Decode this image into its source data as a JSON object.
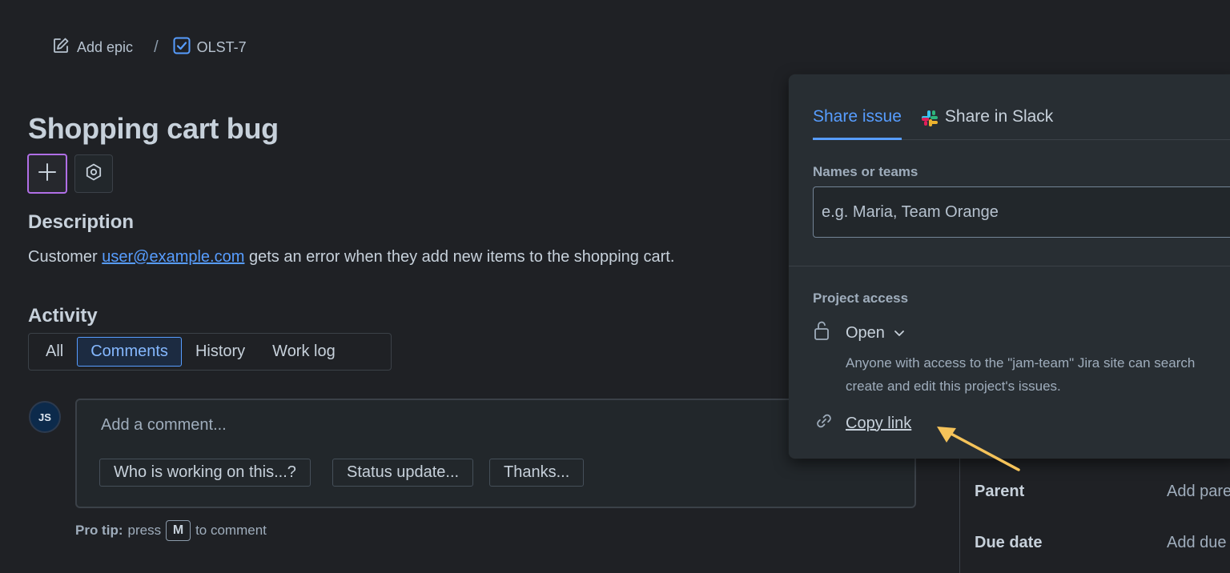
{
  "breadcrumb": {
    "epic_label": "Add epic",
    "separator": "/",
    "issue_key": "OLST-7"
  },
  "issue": {
    "title": "Shopping cart bug"
  },
  "description": {
    "heading": "Description",
    "text_before": "Customer ",
    "email": "user@example.com",
    "text_after": " gets an error when they add new items to the shopping cart."
  },
  "activity": {
    "heading": "Activity",
    "tabs": [
      {
        "label": "All",
        "active": false
      },
      {
        "label": "Comments",
        "active": true
      },
      {
        "label": "History",
        "active": false
      },
      {
        "label": "Work log",
        "active": false
      }
    ]
  },
  "comment": {
    "avatar_initials": "JS",
    "placeholder": "Add a comment...",
    "quick_replies": [
      "Who is working on this...?",
      "Status update...",
      "Thanks..."
    ],
    "protip_bold": "Pro tip:",
    "protip_press": "press",
    "protip_key": "M",
    "protip_suffix": "to comment"
  },
  "details": {
    "rows": [
      {
        "label": "Parent",
        "value": "Add parent"
      },
      {
        "label": "Due date",
        "value": "Add due date"
      }
    ]
  },
  "share": {
    "tabs": [
      {
        "label": "Share issue",
        "active": true
      },
      {
        "label": "Share in Slack",
        "active": false
      }
    ],
    "names_label": "Names or teams",
    "names_placeholder": "e.g. Maria, Team Orange",
    "access_label": "Project access",
    "access_value": "Open",
    "access_description_line1": "Anyone with access to the \"jam-team\" Jira site can search",
    "access_description_line2": "create and edit this project's issues.",
    "copy_link_label": "Copy link"
  },
  "colors": {
    "background": "#1f2125",
    "accent": "#579dff",
    "focus_ring": "#b06fe6",
    "annotation_arrow": "#f5c35a"
  },
  "icons": {
    "epic": "edit-icon",
    "issue_type": "checkbox-icon",
    "add": "plus-icon",
    "settings": "hexagon-settings-icon",
    "slack": "slack-icon",
    "lock": "unlock-icon",
    "chevron": "chevron-down-icon",
    "link": "link-icon"
  }
}
